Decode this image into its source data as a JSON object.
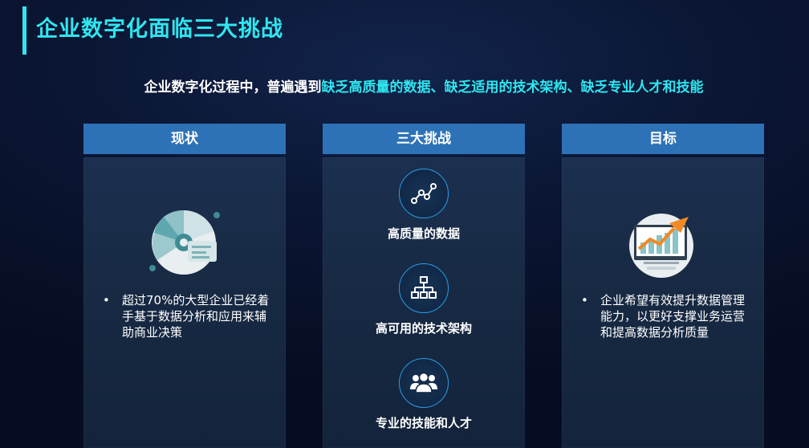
{
  "header": {
    "title": "企业数字化面临三大挑战",
    "accent_color": "#2fe6ef"
  },
  "subtitle": {
    "prefix": "企业数字化过程中，普遍遇到",
    "highlight": "缺乏高质量的数据、缺乏适用的技术架构、缺乏专业人才和技能"
  },
  "columns": {
    "current": {
      "header": "现状",
      "icon": "pie-chart-icon",
      "bullet": "•",
      "text": "超过70%的大型企业已经着手基于数据分析和应用来辅助商业决策"
    },
    "challenges": {
      "header": "三大挑战",
      "items": [
        {
          "icon": "line-trend-icon",
          "label": "高质量的数据"
        },
        {
          "icon": "hierarchy-icon",
          "label": "高可用的技术架构"
        },
        {
          "icon": "people-group-icon",
          "label": "专业的技能和人才"
        }
      ]
    },
    "goal": {
      "header": "目标",
      "icon": "monitor-growth-chart-icon",
      "bullet": "•",
      "text": "企业希望有效提升数据管理能力，以更好支撑业务运营和提高数据分析质量"
    }
  },
  "colors": {
    "header_bg": "#2d72b6",
    "panel_bg": "#182a44",
    "circle_border": "#2a9fe8"
  }
}
